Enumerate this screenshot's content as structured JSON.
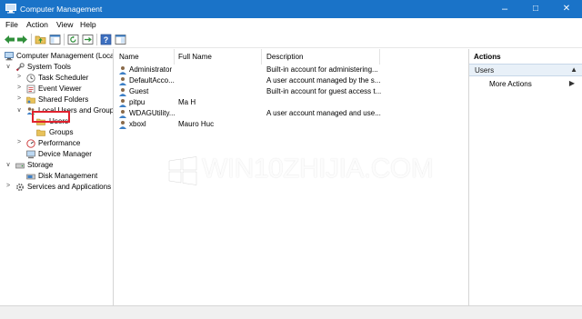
{
  "window": {
    "title": "Computer Management",
    "controls": {
      "minimize": "–",
      "maximize": "□",
      "close": "✕"
    }
  },
  "menubar": {
    "items": [
      "File",
      "Action",
      "View",
      "Help"
    ]
  },
  "toolbar": {
    "icons": [
      "back-icon",
      "forward-icon",
      "up-folder-icon",
      "show-hide-tree-icon",
      "refresh-icon",
      "export-list-icon",
      "help-icon",
      "properties-icon"
    ]
  },
  "tree": {
    "items": [
      {
        "label": "Computer Management (Local",
        "icon": "computer-management-icon",
        "expander": ""
      },
      {
        "label": "System Tools",
        "icon": "tools-icon",
        "expander": "∨"
      },
      {
        "label": "Task Scheduler",
        "icon": "clock-icon",
        "expander": ">"
      },
      {
        "label": "Event Viewer",
        "icon": "event-viewer-icon",
        "expander": ">"
      },
      {
        "label": "Shared Folders",
        "icon": "shared-folder-icon",
        "expander": ">"
      },
      {
        "label": "Local Users and Groups",
        "icon": "users-group-icon",
        "expander": "∨"
      },
      {
        "label": "Users",
        "icon": "folder-icon",
        "expander": ""
      },
      {
        "label": "Groups",
        "icon": "folder-icon",
        "expander": ""
      },
      {
        "label": "Performance",
        "icon": "performance-icon",
        "expander": ">"
      },
      {
        "label": "Device Manager",
        "icon": "device-manager-icon",
        "expander": ""
      },
      {
        "label": "Storage",
        "icon": "storage-icon",
        "expander": "∨"
      },
      {
        "label": "Disk Management",
        "icon": "disk-icon",
        "expander": ""
      },
      {
        "label": "Services and Applications",
        "icon": "services-icon",
        "expander": ">"
      }
    ]
  },
  "list": {
    "columns": [
      "Name",
      "Full Name",
      "Description"
    ],
    "rows": [
      {
        "name": "Administrator",
        "full_name": "",
        "description": "Built-in account for administering..."
      },
      {
        "name": "DefaultAcco...",
        "full_name": "",
        "description": "A user account managed by the s..."
      },
      {
        "name": "Guest",
        "full_name": "",
        "description": "Built-in account for guest access t..."
      },
      {
        "name": "pitpu",
        "full_name": "Ma H",
        "description": ""
      },
      {
        "name": "WDAGUtility...",
        "full_name": "",
        "description": "A user account managed and use..."
      },
      {
        "name": "xboxl",
        "full_name": "Mauro Huc",
        "description": ""
      }
    ]
  },
  "actions": {
    "title": "Actions",
    "section": "Users",
    "section_arrow": "▲",
    "more": "More Actions",
    "more_arrow": "▶"
  },
  "watermark": {
    "text": "WIN10ZHIJIA.COM"
  },
  "colors": {
    "titlebar": "#1a73c8",
    "selection_highlight": "#e0222e",
    "actions_section_bg": "#e8f0f8"
  }
}
